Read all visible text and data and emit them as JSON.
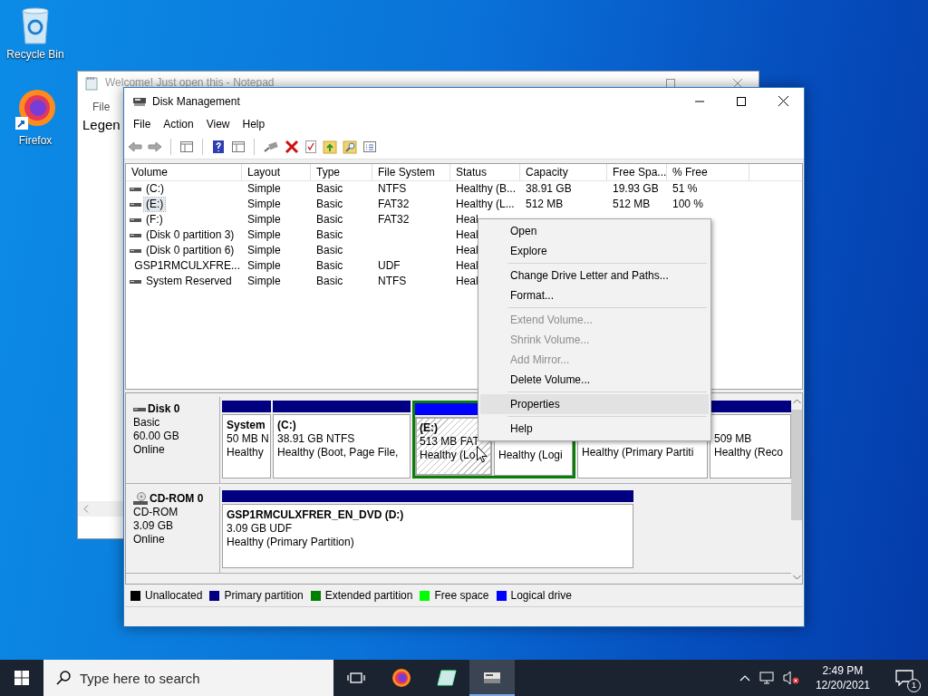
{
  "desktop_icons": [
    {
      "kind": "recycle_bin",
      "label": "Recycle Bin"
    },
    {
      "kind": "firefox",
      "label": "Firefox"
    }
  ],
  "notepad": {
    "title": "Welcome! Just open this - Notepad",
    "menu": [
      "File"
    ],
    "text": "Legen"
  },
  "window": {
    "title": "Disk Management",
    "menu": [
      "File",
      "Action",
      "View",
      "Help"
    ]
  },
  "volume_table": {
    "columns": [
      "Volume",
      "Layout",
      "Type",
      "File System",
      "Status",
      "Capacity",
      "Free Spa...",
      "% Free"
    ],
    "rows": [
      {
        "kind": "disk",
        "volume": "(C:)",
        "selected": false,
        "layout": "Simple",
        "type": "Basic",
        "file_system": "NTFS",
        "status": "Healthy (B...",
        "capacity": "38.91 GB",
        "free_space": "19.93 GB",
        "percent_free": "51 %"
      },
      {
        "kind": "disk",
        "volume": "(E:)",
        "selected": true,
        "layout": "Simple",
        "type": "Basic",
        "file_system": "FAT32",
        "status": "Healthy (L...",
        "capacity": "512 MB",
        "free_space": "512 MB",
        "percent_free": "100 %"
      },
      {
        "kind": "disk",
        "volume": "(F:)",
        "selected": false,
        "layout": "Simple",
        "type": "Basic",
        "file_system": "FAT32",
        "status": "Heal"
      },
      {
        "kind": "disk",
        "volume": "(Disk 0 partition 3)",
        "selected": false,
        "layout": "Simple",
        "type": "Basic",
        "status": "Heal"
      },
      {
        "kind": "disk",
        "volume": "(Disk 0 partition 6)",
        "selected": false,
        "layout": "Simple",
        "type": "Basic",
        "status": "Heal"
      },
      {
        "kind": "cd",
        "volume": "GSP1RMCULXFRE...",
        "selected": false,
        "layout": "Simple",
        "type": "Basic",
        "file_system": "UDF",
        "status": "Heal"
      },
      {
        "kind": "disk",
        "volume": "System Reserved",
        "selected": false,
        "layout": "Simple",
        "type": "Basic",
        "file_system": "NTFS",
        "status": "Heal"
      }
    ]
  },
  "disks": [
    {
      "kind": "disk",
      "name": "Disk 0",
      "info": [
        "Basic",
        "60.00 GB",
        "Online"
      ],
      "partitions": [
        {
          "kind": "primary",
          "name": "System",
          "size": "50 MB N",
          "status": "Healthy",
          "selected": false
        },
        {
          "kind": "primary",
          "name": "(C:)",
          "size": "38.91 GB NTFS",
          "status": "Healthy (Boot, Page File,",
          "selected": false
        },
        {
          "kind": "extended",
          "children": [
            {
              "kind": "logical",
              "name": "(E:)",
              "size": "513 MB FAT",
              "status": "Healthy (Lo",
              "selected": true
            },
            {
              "kind": "logical",
              "status": "Healthy (Logi",
              "selected": false
            }
          ]
        },
        {
          "kind": "primary",
          "status": "Healthy (Primary Partiti",
          "selected": false
        },
        {
          "kind": "primary",
          "size": "509 MB",
          "status": "Healthy (Reco",
          "selected": false
        }
      ]
    },
    {
      "kind": "cdrom",
      "name": "CD-ROM 0",
      "info": [
        "CD-ROM",
        "3.09 GB",
        "Online"
      ],
      "partitions": [
        {
          "kind": "primary",
          "name": "GSP1RMCULXFRER_EN_DVD (D:)",
          "size": "3.09 GB UDF",
          "status": "Healthy (Primary Partition)",
          "selected": false
        }
      ]
    }
  ],
  "legend": [
    {
      "label": "Unallocated",
      "color": "#000000"
    },
    {
      "label": "Primary partition",
      "color": "#000080"
    },
    {
      "label": "Extended partition",
      "color": "#008000"
    },
    {
      "label": "Free space",
      "color": "#00ff00"
    },
    {
      "label": "Logical drive",
      "color": "#0000ff"
    }
  ],
  "context_menu": {
    "items": [
      {
        "kind": "item",
        "label": "Open",
        "disabled": false,
        "selected": false
      },
      {
        "kind": "item",
        "label": "Explore",
        "disabled": false,
        "selected": false
      },
      {
        "kind": "separator"
      },
      {
        "kind": "item",
        "label": "Change Drive Letter and Paths...",
        "disabled": false,
        "selected": false
      },
      {
        "kind": "item",
        "label": "Format...",
        "disabled": false,
        "selected": false
      },
      {
        "kind": "separator"
      },
      {
        "kind": "item",
        "label": "Extend Volume...",
        "disabled": true,
        "selected": false
      },
      {
        "kind": "item",
        "label": "Shrink Volume...",
        "disabled": true,
        "selected": false
      },
      {
        "kind": "item",
        "label": "Add Mirror...",
        "disabled": true,
        "selected": false
      },
      {
        "kind": "item",
        "label": "Delete Volume...",
        "disabled": false,
        "selected": false
      },
      {
        "kind": "separator"
      },
      {
        "kind": "item",
        "label": "Properties",
        "disabled": false,
        "selected": true
      },
      {
        "kind": "separator"
      },
      {
        "kind": "item",
        "label": "Help",
        "disabled": false,
        "selected": false
      }
    ]
  },
  "taskbar": {
    "search": {
      "placeholder": "Type here to search"
    },
    "apps": [
      {
        "kind": "task_view",
        "selected": false
      },
      {
        "kind": "firefox",
        "selected": false
      },
      {
        "kind": "notepad",
        "selected": false
      },
      {
        "kind": "disk_management",
        "selected": true
      }
    ],
    "time": "2:49 PM",
    "date": "12/20/2021",
    "notifications": "1"
  }
}
